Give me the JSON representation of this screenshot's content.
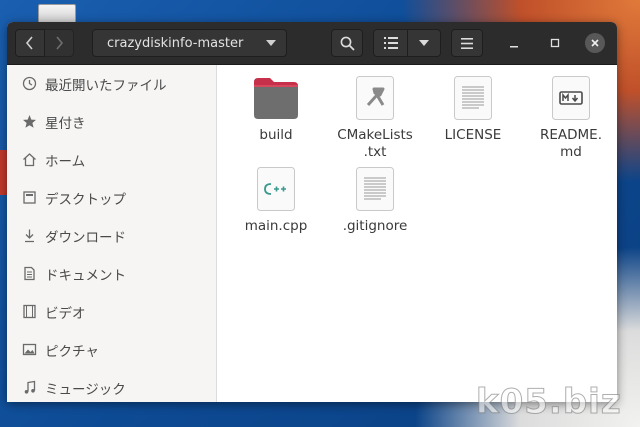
{
  "header": {
    "path_label": "crazydiskinfo-master"
  },
  "sidebar": {
    "items": [
      {
        "label": "最近開いたファイル",
        "icon": "clock-icon"
      },
      {
        "label": "星付き",
        "icon": "star-icon"
      },
      {
        "label": "ホーム",
        "icon": "home-icon"
      },
      {
        "label": "デスクトップ",
        "icon": "desktop-icon"
      },
      {
        "label": "ダウンロード",
        "icon": "download-icon"
      },
      {
        "label": "ドキュメント",
        "icon": "document-icon"
      },
      {
        "label": "ビデオ",
        "icon": "video-icon"
      },
      {
        "label": "ピクチャ",
        "icon": "picture-icon"
      },
      {
        "label": "ミュージック",
        "icon": "music-icon"
      }
    ]
  },
  "files": [
    {
      "label": "build",
      "icon": "folder-icon"
    },
    {
      "label": "CMakeLists\n.txt",
      "icon": "cmake-file-icon"
    },
    {
      "label": "LICENSE",
      "icon": "text-file-icon"
    },
    {
      "label": "README.\nmd",
      "icon": "markdown-file-icon"
    },
    {
      "label": "main.cpp",
      "icon": "cpp-file-icon"
    },
    {
      "label": ".gitignore",
      "icon": "text-file-icon"
    }
  ],
  "colors": {
    "headerbar": "#2c2c2c",
    "folder_tab": "#c7304a",
    "folder_body": "#6e6e6e",
    "sidebar_bg": "#f6f5f4"
  },
  "watermark": "k05.biz"
}
